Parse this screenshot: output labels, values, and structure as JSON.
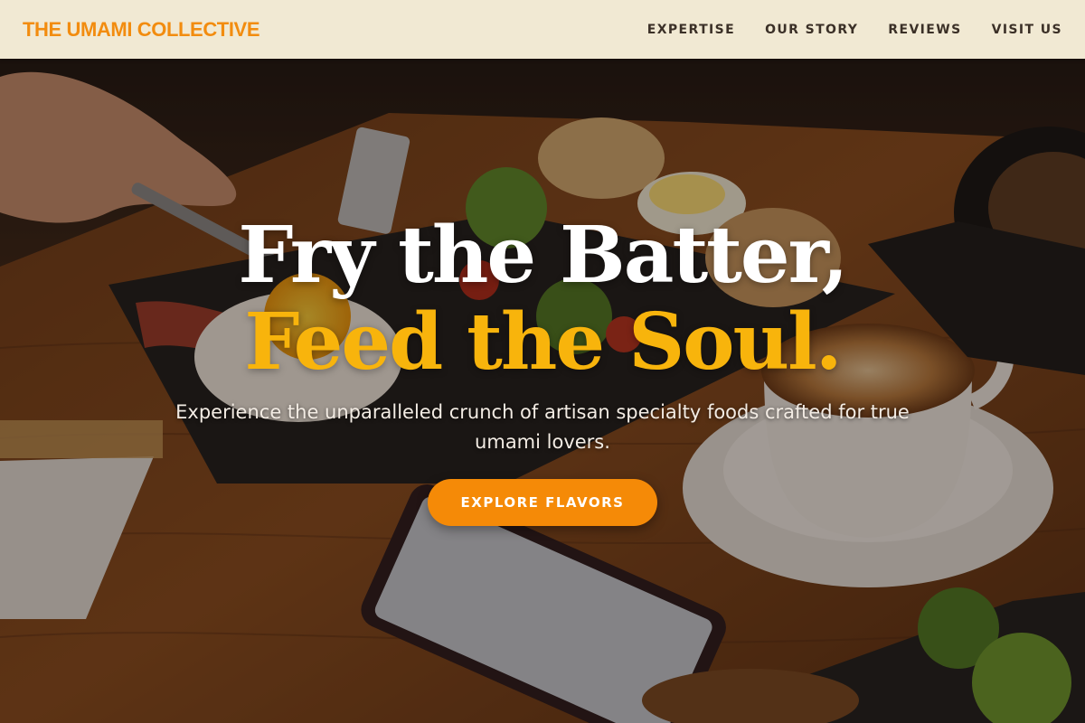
{
  "nav": {
    "brand": "THE UMAMI COLLECTIVE",
    "links": [
      "EXPERTISE",
      "OUR STORY",
      "REVIEWS",
      "VISIT US"
    ]
  },
  "hero": {
    "headline_line1": "Fry the Batter,",
    "headline_line2": "Feed the Soul.",
    "subtext": "Experience the unparalleled crunch of artisan specialty foods crafted for true umami lovers.",
    "cta_label": "EXPLORE FLAVORS",
    "background_image": "cafe-table-breakfast-photo"
  },
  "colors": {
    "brand": "#f28c0f",
    "nav_bg": "#f1e9d3",
    "headline_accent": "#f8b40c",
    "cta": "#f58a07"
  }
}
